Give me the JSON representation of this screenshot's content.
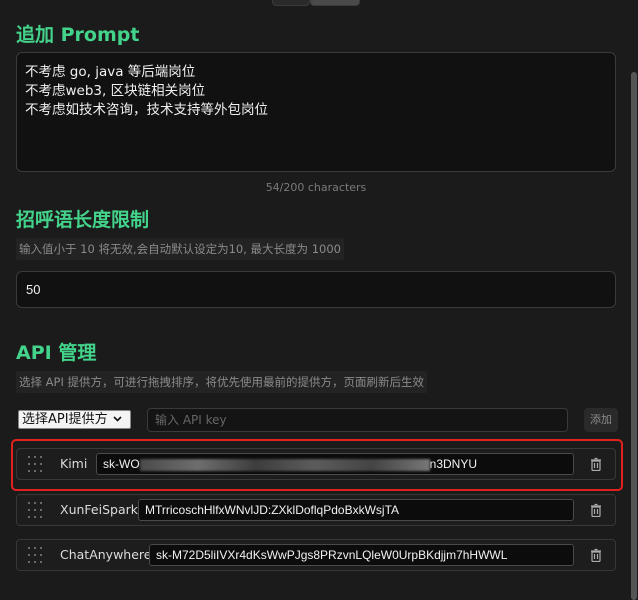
{
  "prompt_section": {
    "title": "追加 Prompt",
    "content": "不考虑 go, java 等后端岗位\n不考虑web3, 区块链相关岗位\n不考虑如技术咨询，技术支持等外包岗位",
    "char_count": "54/200 characters"
  },
  "greeting_section": {
    "title": "招呼语长度限制",
    "hint": "输入值小于 10 将无效,会自动默认设定为10, 最大长度为 1000",
    "value": "50"
  },
  "api_section": {
    "title": "API 管理",
    "hint": "选择 API 提供方，可进行拖拽排序，将优先使用最前的提供方，页面刷新后生效",
    "select_label": "选择API提供方",
    "key_placeholder": "输入 API key",
    "add_label": "添加",
    "providers": [
      {
        "name": "Kimi",
        "key_prefix": "sk-WO",
        "key_suffix": "n3DNYU",
        "highlighted": true
      },
      {
        "name": "XunFeiSpark",
        "key": "MTrricoschHlfxWNvlJD:ZXklDoflqPdoBxkWsjTA"
      },
      {
        "name": "ChatAnywhere",
        "key": "sk-M72D5liIVXr4dKsWwPJgs8PRzvnLQleW0UrpBKdjjm7hHWWL"
      }
    ]
  },
  "icons": {
    "drag": "drag-handle-icon",
    "delete": "trash-icon",
    "select": "chevron-down-icon"
  },
  "colors": {
    "accent": "#43d38a",
    "highlight": "#e0221e",
    "background": "#1b1b1b"
  }
}
